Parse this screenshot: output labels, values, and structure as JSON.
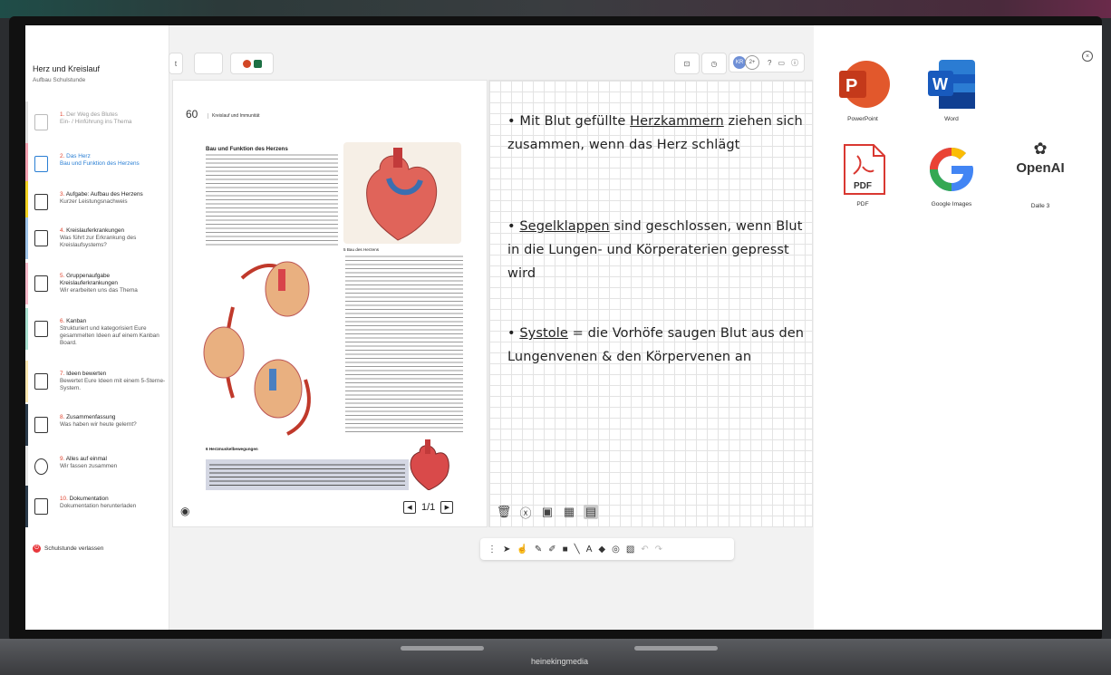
{
  "sidebar": {
    "title": "Herz und Kreislauf",
    "subtitle": "Aufbau Schulstunde",
    "items": [
      {
        "num": "1.",
        "title": "Der Weg des Blutes",
        "desc": "Ein- / Hinführung ins Thema",
        "color": "#e0e0e0"
      },
      {
        "num": "2.",
        "title": "Das Herz",
        "desc": "Bau und Funktion des Herzens",
        "color": "#f2a0b0"
      },
      {
        "num": "3.",
        "title": "Aufgabe: Aufbau des Herzens",
        "desc": "Kurzer Leistungsnachweis",
        "color": "#f0d020"
      },
      {
        "num": "4.",
        "title": "Kreislauferkrankungen",
        "desc": "Was führt zur Erkrankung des Kreislaufsystems?",
        "color": "#9ec3e8"
      },
      {
        "num": "5.",
        "title": "Gruppenaufgabe Kreislauferkrankungen",
        "desc": "Wir erarbeiten uns das Thema",
        "color": "#f6b8c8"
      },
      {
        "num": "6.",
        "title": "Kanban",
        "desc": "Strukturiert und kategorisiert Eure gesammelten Ideen auf einem Kanban Board.",
        "color": "#a8e0d0"
      },
      {
        "num": "7.",
        "title": "Ideen bewerten",
        "desc": "Bewertet Eure Ideen mit einem 5-Sterne-System.",
        "color": "#fbe6b0"
      },
      {
        "num": "8.",
        "title": "Zusammenfassung",
        "desc": "Was haben wir heute gelernt?",
        "color": "#2a3a4a"
      },
      {
        "num": "9.",
        "title": "Alles auf einmal",
        "desc": "Wir fassen zusammen",
        "color": "#e6e6e6"
      },
      {
        "num": "10.",
        "title": "Dokumentation",
        "desc": "Dokumentation herunterladen",
        "color": "#2a3a4a"
      }
    ],
    "leave": "Schulstunde verlassen"
  },
  "toolbar": {
    "left_btn": "t",
    "avatar": "KR",
    "more_users": "2+",
    "help": "?"
  },
  "document": {
    "page_number": "60",
    "page_caption": "Kreislauf und Immunität",
    "heading": "Bau und Funktion des Herzens",
    "fig5_caption": "5 Bau des Herzens",
    "fig6_caption": "6 Herzmuskelbewegungen",
    "pager": "1/1"
  },
  "board": {
    "notes": [
      {
        "pre": "• Mit Blut gefüllte ",
        "u": "Herzkammern",
        "post": " ziehen sich zusammen, wenn das Herz schlägt"
      },
      {
        "pre": "• ",
        "u": "Segelklappen",
        "post": " sind geschlossen, wenn Blut in die Lungen- und Körperaterien gepresst wird"
      },
      {
        "pre": "• ",
        "u": "Systole",
        "post": " = die Vorhöfe saugen Blut aus den Lungenvenen & den Körpervenen an"
      }
    ]
  },
  "apps": [
    {
      "label": "PowerPoint"
    },
    {
      "label": "Word"
    },
    {
      "label": "OpenAI"
    },
    {
      "label": "PDF"
    },
    {
      "label": "Google Images"
    },
    {
      "label": "Dalle 3"
    }
  ],
  "brand": "heinekingmedia"
}
